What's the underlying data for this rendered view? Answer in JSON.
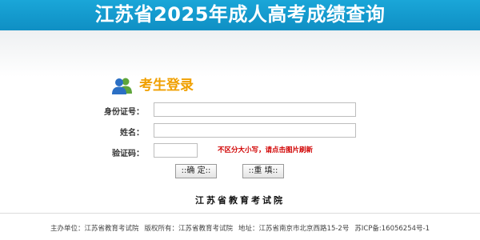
{
  "header": {
    "title": "江苏省2025年成人高考成绩查询"
  },
  "login": {
    "icon": "users-icon",
    "title": "考生登录",
    "id_label": "身份证号：",
    "id_value": "",
    "name_label": "姓名：",
    "name_value": "",
    "captcha_label": "验证码：",
    "captcha_value": "",
    "captcha_hint": "不区分大小写，请点击图片刷新",
    "confirm_label": "::确 定::",
    "reset_label": "::重 填::"
  },
  "org": {
    "name": "江苏省教育考试院"
  },
  "footer": {
    "host": "主办单位：江苏省教育考试院",
    "copyright": "版权所有：江苏省教育考试院",
    "address": "地址：江苏省南京市北京西路15-2号",
    "icp": "苏ICP备:16056254号-1"
  },
  "colors": {
    "header_bg": "#1aa6d8",
    "login_title": "#f0a000",
    "hint": "#d10000"
  }
}
